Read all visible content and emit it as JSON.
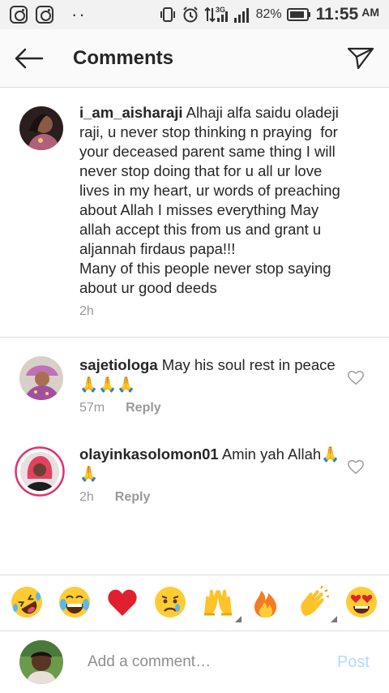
{
  "status_bar": {
    "network": "3G",
    "battery_percent": "82%",
    "time": "11:55",
    "ampm": "AM",
    "icons": [
      "instagram-icon",
      "instagram-icon",
      "dots-icon",
      "vibrate-icon",
      "alarm-icon",
      "data-arrows-icon",
      "signal-icon",
      "signal-icon",
      "battery-icon"
    ]
  },
  "header": {
    "title": "Comments",
    "back_icon": "arrow-left-icon",
    "share_icon": "paper-plane-icon"
  },
  "caption": {
    "username": "i_am_aisharaji",
    "text": " Alhaji alfa saidu oladeji raji, u never stop thinking n praying  for your deceased parent same thing I will never stop doing that for u all ur love lives in my heart, ur words of preaching about Allah I misses everything May allah accept this from us and grant u aljannah firdaus papa!!!\nMany of this people never stop saying about ur good deeds",
    "time": "2h"
  },
  "comments": [
    {
      "username": "sajetiologa",
      "text": " May his soul rest in peace🙏🙏🙏",
      "time": "57m",
      "reply": "Reply"
    },
    {
      "username": "olayinkasolomon01",
      "text": " Amin yah Allah🙏🙏",
      "time": "2h",
      "reply": "Reply"
    }
  ],
  "emoji_bar": [
    "rolling-on-floor-laughing",
    "tears-of-joy",
    "red-heart",
    "crying-face",
    "raising-hands",
    "fire",
    "clapping-hands",
    "heart-eyes"
  ],
  "input": {
    "placeholder": "Add a comment…",
    "post_label": "Post"
  },
  "colors": {
    "post_button": "#b3dbff",
    "meta_text": "#999999",
    "story_ring": "#e1306c"
  }
}
